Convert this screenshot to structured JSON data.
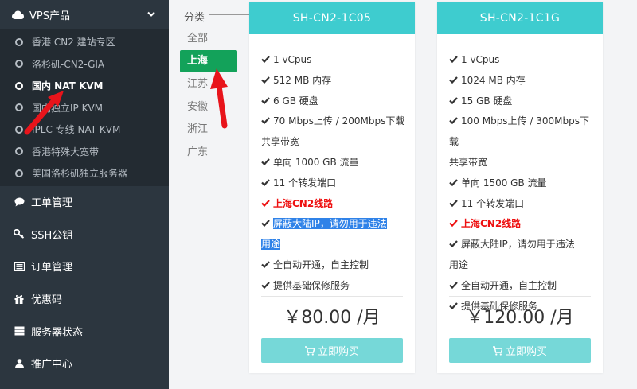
{
  "sidebar": {
    "vps_label": "VPS产品",
    "sub_items": [
      {
        "label": "香港 CN2 建站专区",
        "active": false
      },
      {
        "label": "洛杉矶-CN2-GIA",
        "active": false
      },
      {
        "label": "国内 NAT KVM",
        "active": true
      },
      {
        "label": "国内独立IP KVM",
        "active": false
      },
      {
        "label": "IPLC 专线 NAT KVM",
        "active": false
      },
      {
        "label": "香港特殊大宽带",
        "active": false
      },
      {
        "label": "美国洛杉矶独立服务器",
        "active": false
      }
    ],
    "nav_items": [
      {
        "label": "工单管理",
        "icon": "comment-icon"
      },
      {
        "label": "SSH公钥",
        "icon": "key-icon"
      },
      {
        "label": "订单管理",
        "icon": "list-icon"
      },
      {
        "label": "优惠码",
        "icon": "gift-icon"
      },
      {
        "label": "服务器状态",
        "icon": "server-icon"
      },
      {
        "label": "推广中心",
        "icon": "user-icon"
      }
    ]
  },
  "categories": {
    "title": "分类",
    "items": [
      "全部",
      "上海",
      "江苏",
      "安徽",
      "浙江",
      "广东"
    ],
    "active": "上海"
  },
  "plans": [
    {
      "name": "SH-CN2-1C05",
      "features": [
        "1 vCpus",
        "512 MB 内存",
        "6 GB 硬盘",
        "70 Mbps上传 / 200Mbps下载",
        "共享带宽",
        "单向 1000 GB 流量",
        "11 个转发端口",
        "上海CN2线路",
        "屏蔽大陆IP，请勿用于违法",
        "用途",
        "全自动开通，自主控制",
        "提供基础保修服务"
      ],
      "price": "￥80.00 /月",
      "buy_label": "立即购买"
    },
    {
      "name": "SH-CN2-1C1G",
      "features": [
        "1 vCpus",
        "1024 MB 内存",
        "15 GB 硬盘",
        "100 Mbps上传 / 300Mbps下载",
        "共享带宽",
        "单向 1500 GB 流量",
        "11 个转发端口",
        "上海CN2线路",
        "屏蔽大陆IP，请勿用于违法",
        "用途",
        "全自动开通，自主控制",
        "提供基础保修服务"
      ],
      "price": "￥120.00 /月",
      "buy_label": "立即购买"
    }
  ],
  "colors": {
    "sidebar_bg": "#2c363f",
    "card_header": "#3ecccf",
    "active_category": "#13a25a",
    "buy_button": "#76d8d8",
    "annotation_arrow": "#e8141b"
  }
}
